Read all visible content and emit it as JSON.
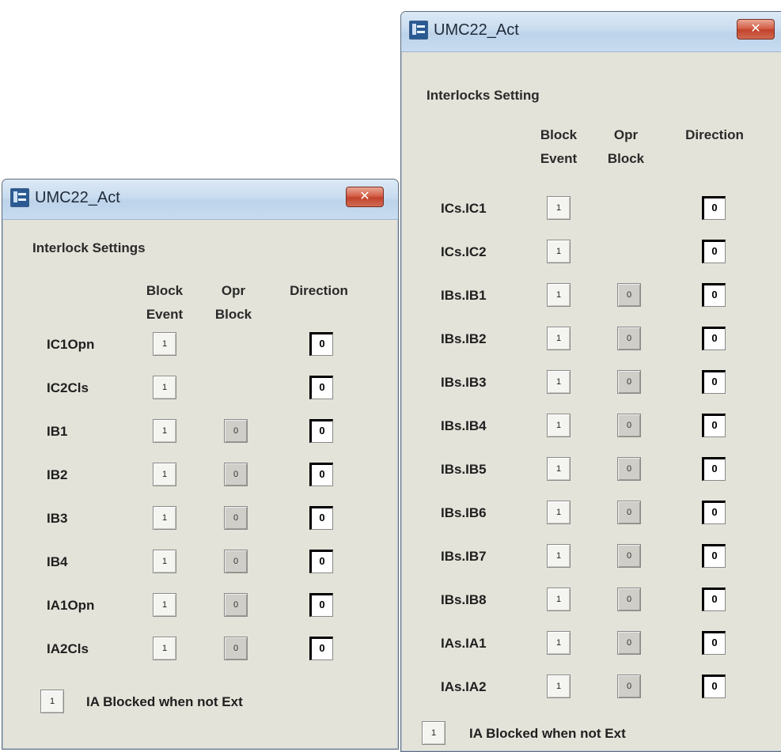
{
  "left_window": {
    "title": "UMC22_Act",
    "close_glyph": "✕",
    "section_title": "Interlock Settings",
    "headers": {
      "block_event": [
        "Block",
        "Event"
      ],
      "opr_block": [
        "Opr",
        "Block"
      ],
      "direction": "Direction"
    },
    "rows": [
      {
        "label": "IC1Opn",
        "block_event": "1",
        "opr_block": null,
        "direction": "0"
      },
      {
        "label": "IC2Cls",
        "block_event": "1",
        "opr_block": null,
        "direction": "0"
      },
      {
        "label": "IB1",
        "block_event": "1",
        "opr_block": "0",
        "direction": "0"
      },
      {
        "label": "IB2",
        "block_event": "1",
        "opr_block": "0",
        "direction": "0"
      },
      {
        "label": "IB3",
        "block_event": "1",
        "opr_block": "0",
        "direction": "0"
      },
      {
        "label": "IB4",
        "block_event": "1",
        "opr_block": "0",
        "direction": "0"
      },
      {
        "label": "IA1Opn",
        "block_event": "1",
        "opr_block": "0",
        "direction": "0"
      },
      {
        "label": "IA2Cls",
        "block_event": "1",
        "opr_block": "0",
        "direction": "0"
      }
    ],
    "footer": {
      "value": "1",
      "label": "IA Blocked when not Ext"
    }
  },
  "right_window": {
    "title": "UMC22_Act",
    "close_glyph": "✕",
    "section_title": "Interlocks Setting",
    "headers": {
      "block_event": [
        "Block",
        "Event"
      ],
      "opr_block": [
        "Opr",
        "Block"
      ],
      "direction": "Direction"
    },
    "rows": [
      {
        "label": "ICs.IC1",
        "block_event": "1",
        "opr_block": null,
        "direction": "0"
      },
      {
        "label": "ICs.IC2",
        "block_event": "1",
        "opr_block": null,
        "direction": "0"
      },
      {
        "label": "IBs.IB1",
        "block_event": "1",
        "opr_block": "0",
        "direction": "0"
      },
      {
        "label": "IBs.IB2",
        "block_event": "1",
        "opr_block": "0",
        "direction": "0"
      },
      {
        "label": "IBs.IB3",
        "block_event": "1",
        "opr_block": "0",
        "direction": "0"
      },
      {
        "label": "IBs.IB4",
        "block_event": "1",
        "opr_block": "0",
        "direction": "0"
      },
      {
        "label": "IBs.IB5",
        "block_event": "1",
        "opr_block": "0",
        "direction": "0"
      },
      {
        "label": "IBs.IB6",
        "block_event": "1",
        "opr_block": "0",
        "direction": "0"
      },
      {
        "label": "IBs.IB7",
        "block_event": "1",
        "opr_block": "0",
        "direction": "0"
      },
      {
        "label": "IBs.IB8",
        "block_event": "1",
        "opr_block": "0",
        "direction": "0"
      },
      {
        "label": "IAs.IA1",
        "block_event": "1",
        "opr_block": "0",
        "direction": "0"
      },
      {
        "label": "IAs.IA2",
        "block_event": "1",
        "opr_block": "0",
        "direction": "0"
      }
    ],
    "footer": {
      "value": "1",
      "label": "IA Blocked when not Ext"
    }
  }
}
